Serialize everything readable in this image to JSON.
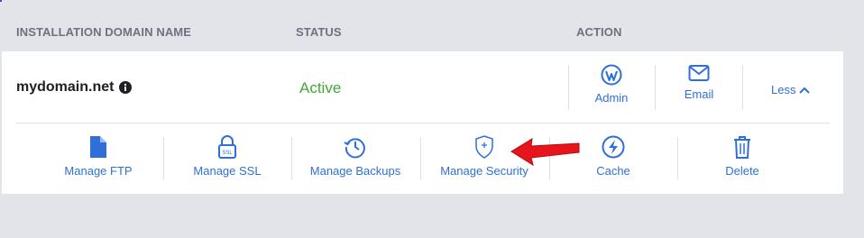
{
  "table": {
    "headers": [
      "INSTALLATION DOMAIN NAME",
      "STATUS",
      "ACTION"
    ]
  },
  "row": {
    "domain": "mydomain.net",
    "status": "Active",
    "actions": [
      {
        "label": "Admin",
        "icon": "wordpress-icon"
      },
      {
        "label": "Email",
        "icon": "envelope-icon"
      }
    ],
    "toggle_label": "Less"
  },
  "tools": [
    {
      "label": "Manage FTP",
      "icon": "file-icon"
    },
    {
      "label": "Manage SSL",
      "icon": "ssl-lock-icon"
    },
    {
      "label": "Manage Backups",
      "icon": "history-clock-icon"
    },
    {
      "label": "Manage Security",
      "icon": "shield-icon"
    },
    {
      "label": "Cache",
      "icon": "lightning-icon"
    },
    {
      "label": "Delete",
      "icon": "trash-icon"
    }
  ],
  "colors": {
    "accent": "#2f6fd8",
    "status_active": "#3eaa32",
    "annotation_arrow": "#e8141b",
    "background": "#e3e3ea"
  }
}
